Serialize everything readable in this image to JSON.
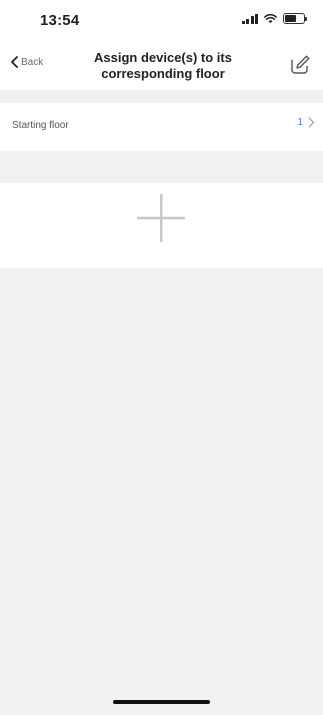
{
  "status_bar": {
    "time": "13:54",
    "icons": [
      "signal-icon",
      "wifi-icon",
      "battery-icon"
    ]
  },
  "nav": {
    "back_label": "Back",
    "title_line1": "Assign device(s) to its",
    "title_line2": "corresponding floor",
    "edit_icon": "edit-icon"
  },
  "settings": {
    "starting_floor_label": "Starting floor",
    "starting_floor_value": "1"
  },
  "add_panel": {
    "icon": "plus-icon"
  },
  "colors": {
    "accent": "#4a7fd4",
    "background": "#f2f2f2",
    "surface": "#ffffff"
  }
}
